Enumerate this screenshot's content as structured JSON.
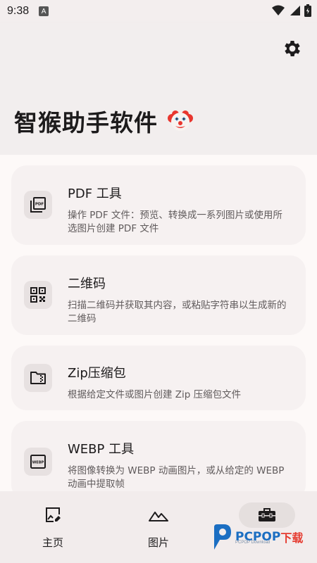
{
  "status_bar": {
    "time": "9:38",
    "notification_letter": "A"
  },
  "header": {
    "title": "智猴助手软件"
  },
  "cards": [
    {
      "title": "PDF 工具",
      "description": "操作 PDF 文件：预览、转换成一系列图片或使用所选图片创建 PDF 文件",
      "icon": "pdf-file-icon"
    },
    {
      "title": "二维码",
      "description": "扫描二维码并获取其内容，或粘贴字符串以生成新的二维码",
      "icon": "qr-code-icon"
    },
    {
      "title": "Zip压缩包",
      "description": "根据给定文件或图片创建 Zip 压缩包文件",
      "icon": "zip-folder-icon"
    },
    {
      "title": "WEBP 工具",
      "description": "将图像转换为 WEBP 动画图片，或从给定的 WEBP 动画中提取帧",
      "icon": "webp-icon"
    }
  ],
  "nav": {
    "items": [
      {
        "label": "主页",
        "icon": "image-edit-icon"
      },
      {
        "label": "图片",
        "icon": "landscape-icon"
      },
      {
        "label": "",
        "icon": "toolbox-icon",
        "active": true
      }
    ]
  },
  "watermark": {
    "brand": "PCPOP",
    "suffix": "下载",
    "sub": "PCPOP Download"
  },
  "colors": {
    "background": "#f3eeee",
    "card": "#f6f1f1",
    "active_pill": "#e5dfde",
    "watermark_blue": "#1b6ec2",
    "watermark_red": "#e53a2f"
  }
}
